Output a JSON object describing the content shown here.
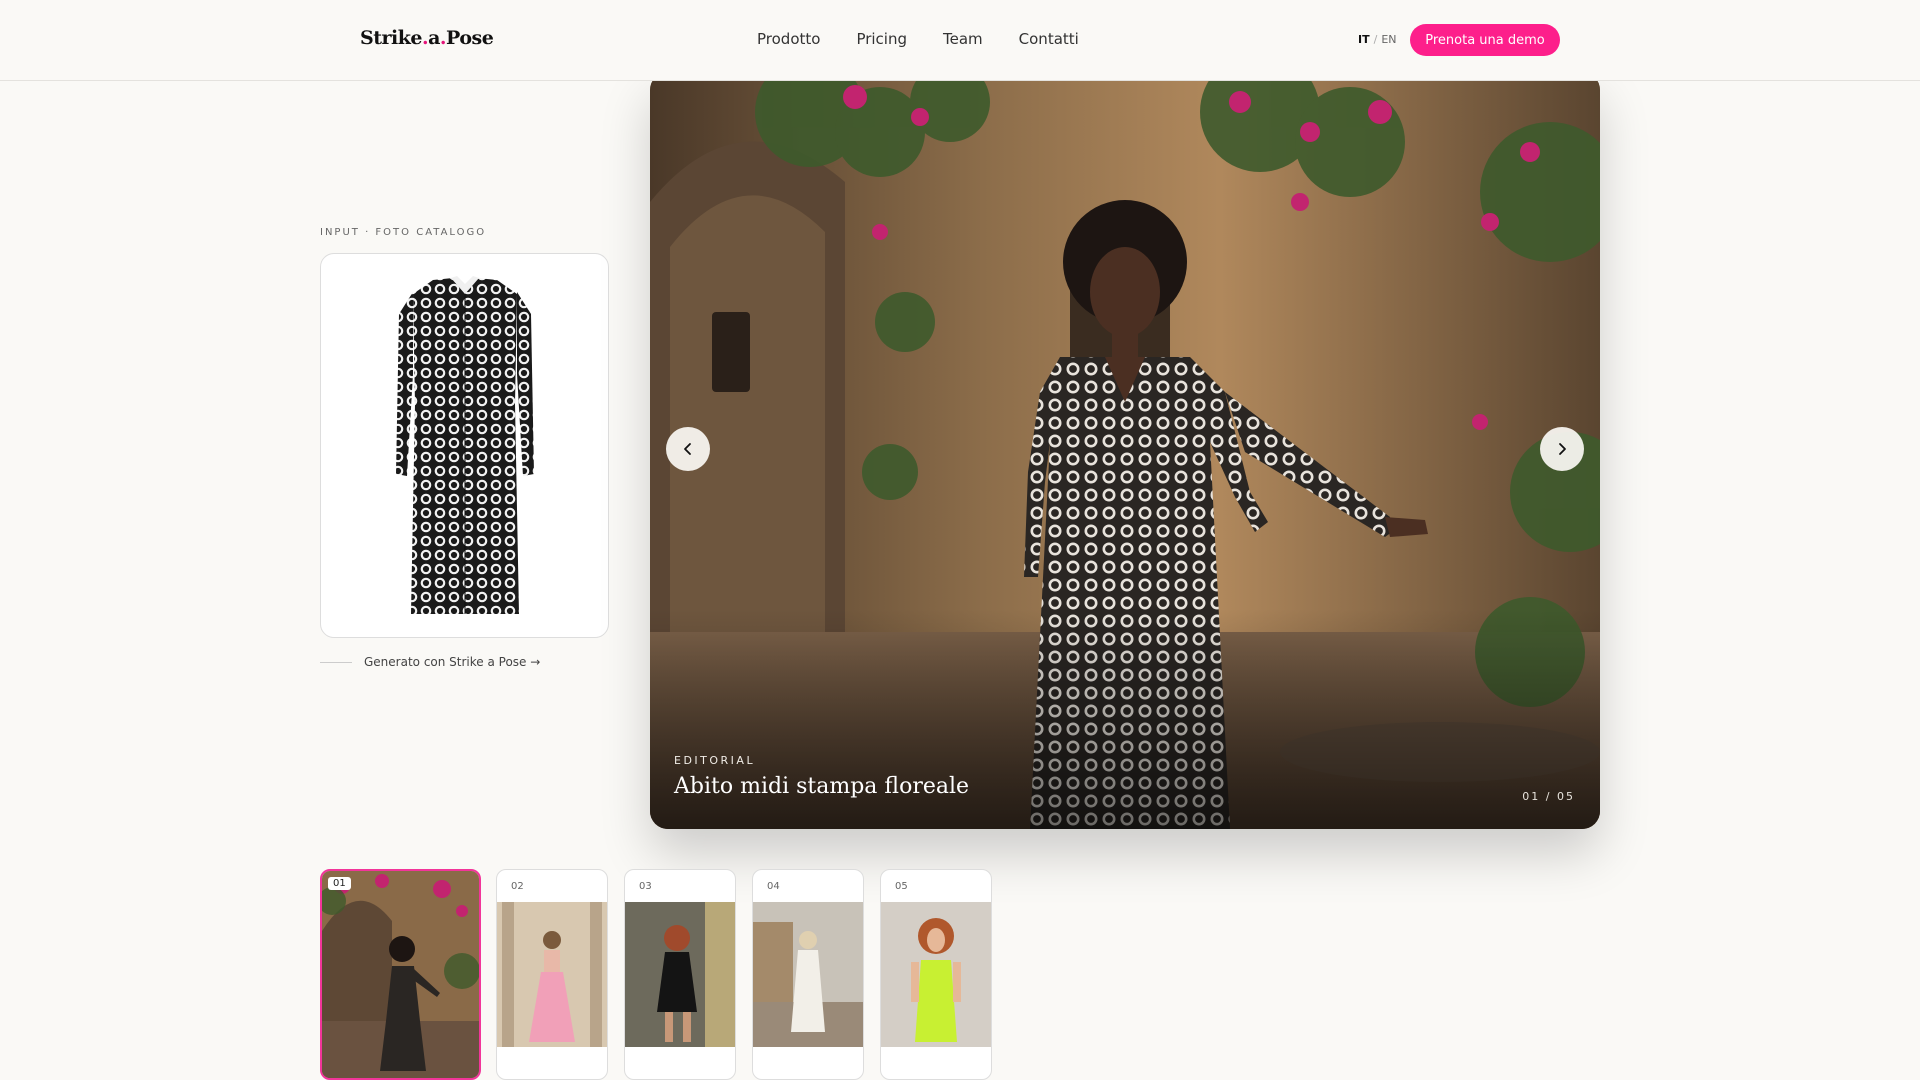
{
  "nav": {
    "logo": {
      "part1": "Strike",
      "dot1": ".",
      "part2": "a",
      "dot2": ".",
      "part3": "Pose"
    },
    "menu": [
      "Prodotto",
      "Pricing",
      "Team",
      "Contatti"
    ],
    "lang": {
      "active": "IT",
      "separator": "/",
      "other": "EN"
    },
    "cta": "Prenota una demo"
  },
  "input": {
    "label": "INPUT · FOTO CATALOGO",
    "generated_link": "Generato con Strike a Pose →"
  },
  "hero": {
    "tag": "EDITORIAL",
    "title": "Abito midi stampa floreale",
    "counter": "01 / 05"
  },
  "thumbnails": [
    {
      "number": "01",
      "active": true
    },
    {
      "number": "02",
      "active": false
    },
    {
      "number": "03",
      "active": false
    },
    {
      "number": "04",
      "active": false
    },
    {
      "number": "05",
      "active": false
    }
  ],
  "colors": {
    "accent": "#fd1f8b",
    "background": "#faf9f6"
  }
}
